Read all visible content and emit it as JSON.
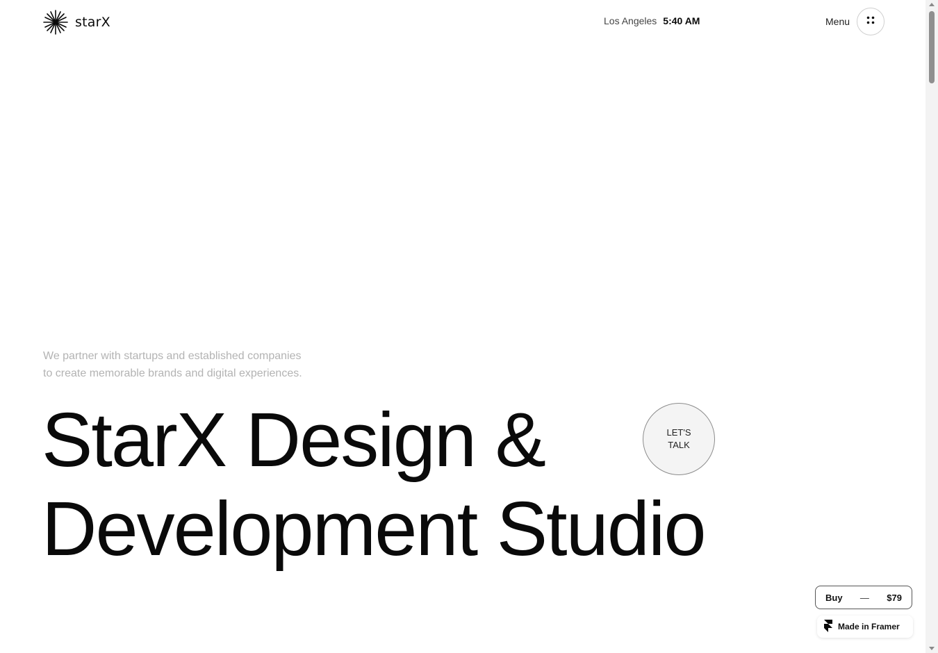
{
  "header": {
    "brand": "starX",
    "clock": {
      "city": "Los Angeles",
      "time": "5:40 AM"
    },
    "menu_label": "Menu"
  },
  "hero": {
    "tagline_line1": "We partner with startups and established companies",
    "tagline_line2": "to create memorable brands and digital experiences.",
    "title_line1": "StarX Design &",
    "title_line2": "Development Studio",
    "cta_line1": "LET'S",
    "cta_line2": "TALK"
  },
  "badges": {
    "buy_label": "Buy",
    "buy_separator": "—",
    "buy_price": "$79",
    "framer_label": "Made in Framer"
  },
  "icons": {
    "logo": "star-burst-icon",
    "menu": "four-dots-icon",
    "framer": "framer-logo-icon"
  },
  "colors": {
    "text": "#0a0a0a",
    "muted": "#b3b3b3",
    "background": "#ffffff"
  }
}
